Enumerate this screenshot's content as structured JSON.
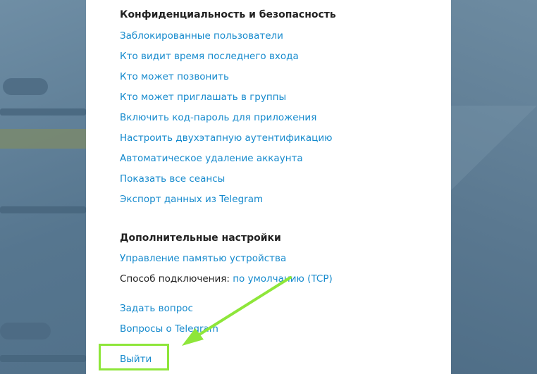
{
  "privacy": {
    "title": "Конфиденциальность и безопасность",
    "items": [
      "Заблокированные пользователи",
      "Кто видит время последнего входа",
      "Кто может позвонить",
      "Кто может приглашать в группы",
      "Включить код-пароль для приложения",
      "Настроить двухэтапную аутентификацию",
      "Автоматическое удаление аккаунта",
      "Показать все сеансы",
      "Экспорт данных из Telegram"
    ]
  },
  "advanced": {
    "title": "Дополнительные настройки",
    "storage": "Управление памятью устройства",
    "connection_label": "Способ подключения: ",
    "connection_value": "по умолчанию (TCP)"
  },
  "help": {
    "ask": "Задать вопрос",
    "faq": "Вопросы о Telegram"
  },
  "logout": "Выйти",
  "colors": {
    "link": "#168acd",
    "highlight": "#8ee63a",
    "background": "#5b7b94"
  }
}
